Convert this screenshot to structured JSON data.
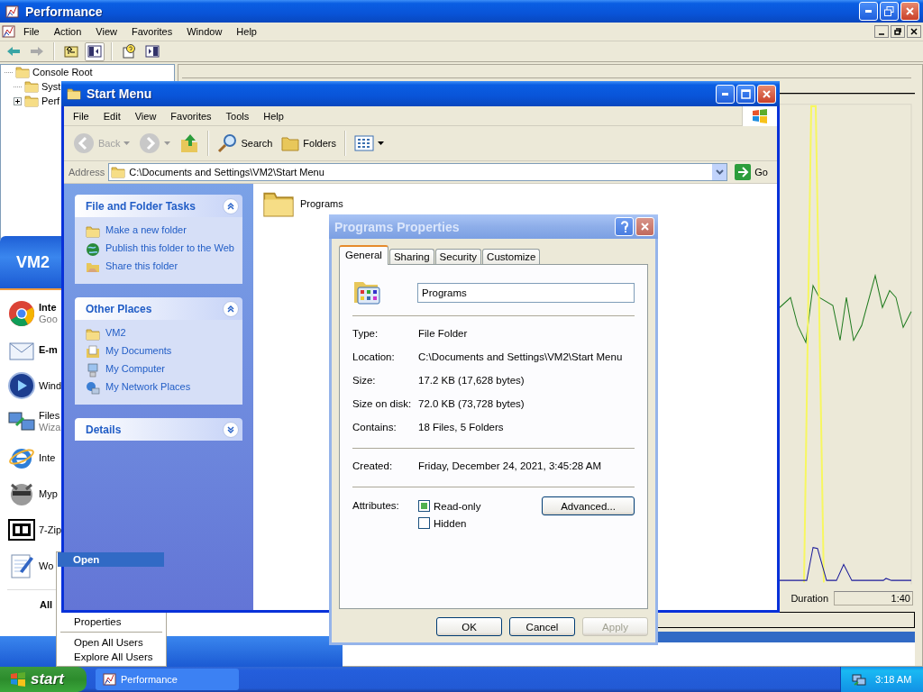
{
  "performance_window": {
    "title": "Performance",
    "menu": [
      "File",
      "Action",
      "View",
      "Favorites",
      "Window",
      "Help"
    ],
    "tree": [
      {
        "label": "Console Root",
        "children": [
          {
            "label": "Syst"
          },
          {
            "label": "Perf",
            "expanded": false
          }
        ]
      }
    ],
    "graph": {
      "duration_label": "Duration",
      "duration_value": "1:40"
    }
  },
  "start_menu": {
    "user": "VM2",
    "programs": [
      {
        "title": "Inte",
        "subtitle": "Goo",
        "pinned": true
      },
      {
        "title": "E-m",
        "pinned": true
      },
      {
        "title": "Wind",
        "pinned": false
      },
      {
        "title": "Files",
        "subtitle": "Wiza",
        "pinned": false
      },
      {
        "title": "Inte",
        "pinned": false
      },
      {
        "title": "Myp",
        "pinned": false
      },
      {
        "title": "7-Zip",
        "pinned": false
      },
      {
        "title": "Wo",
        "pinned": false
      }
    ],
    "all_programs": "All"
  },
  "context_menu": {
    "groups": [
      [
        {
          "label": "Open",
          "selected": true,
          "default": true
        },
        {
          "label": "Properties",
          "selected": false,
          "default": false
        }
      ],
      [
        {
          "label": "Open All Users",
          "selected": false,
          "default": false
        },
        {
          "label": "Explore All Users",
          "selected": false,
          "default": false
        }
      ]
    ]
  },
  "explorer_window": {
    "title": "Start Menu",
    "menu": [
      "File",
      "Edit",
      "View",
      "Favorites",
      "Tools",
      "Help"
    ],
    "toolbar": {
      "back": {
        "label": "Back",
        "disabled": true
      },
      "forward": {
        "disabled": true
      },
      "search": "Search",
      "folders": "Folders"
    },
    "address": {
      "label": "Address",
      "value": "C:\\Documents and Settings\\VM2\\Start Menu",
      "go": "Go"
    },
    "task_panels": [
      {
        "title": "File and Folder Tasks",
        "expanded": true,
        "items": [
          "Make a new folder",
          "Publish this folder to the Web",
          "Share this folder"
        ]
      },
      {
        "title": "Other Places",
        "expanded": true,
        "items": [
          "VM2",
          "My Documents",
          "My Computer",
          "My Network Places"
        ]
      },
      {
        "title": "Details",
        "expanded": false
      }
    ],
    "files": [
      {
        "name": "Programs"
      }
    ]
  },
  "properties_dialog": {
    "title": "Programs Properties",
    "tabs": [
      {
        "label": "General",
        "selected": true
      },
      {
        "label": "Sharing",
        "selected": false
      },
      {
        "label": "Security",
        "selected": false
      },
      {
        "label": "Customize",
        "selected": false
      }
    ],
    "name": "Programs",
    "details": [
      [
        {
          "label": "Type:",
          "value": "File Folder"
        },
        {
          "label": "Location:",
          "value": "C:\\Documents and Settings\\VM2\\Start Menu"
        },
        {
          "label": "Size:",
          "value": "17.2 KB (17,628 bytes)"
        },
        {
          "label": "Size on disk:",
          "value": "72.0 KB (73,728 bytes)"
        },
        {
          "label": "Contains:",
          "value": "18 Files, 5 Folders"
        }
      ],
      [
        {
          "label": "Created:",
          "value": "Friday, December 24, 2021, 3:45:28 AM"
        }
      ]
    ],
    "attributes": {
      "label": "Attributes:",
      "checkboxes": [
        {
          "label": "Read-only",
          "checked": false,
          "indeterminate": true
        },
        {
          "label": "Hidden",
          "checked": false,
          "indeterminate": false
        }
      ],
      "advanced": "Advanced..."
    },
    "buttons": [
      {
        "label": "OK",
        "disabled": false
      },
      {
        "label": "Cancel",
        "disabled": false
      },
      {
        "label": "Apply",
        "disabled": true
      }
    ]
  },
  "taskbar": {
    "start": "start",
    "tasks": [
      {
        "label": "Performance",
        "selected": false
      }
    ],
    "clock": "3:18 AM"
  }
}
